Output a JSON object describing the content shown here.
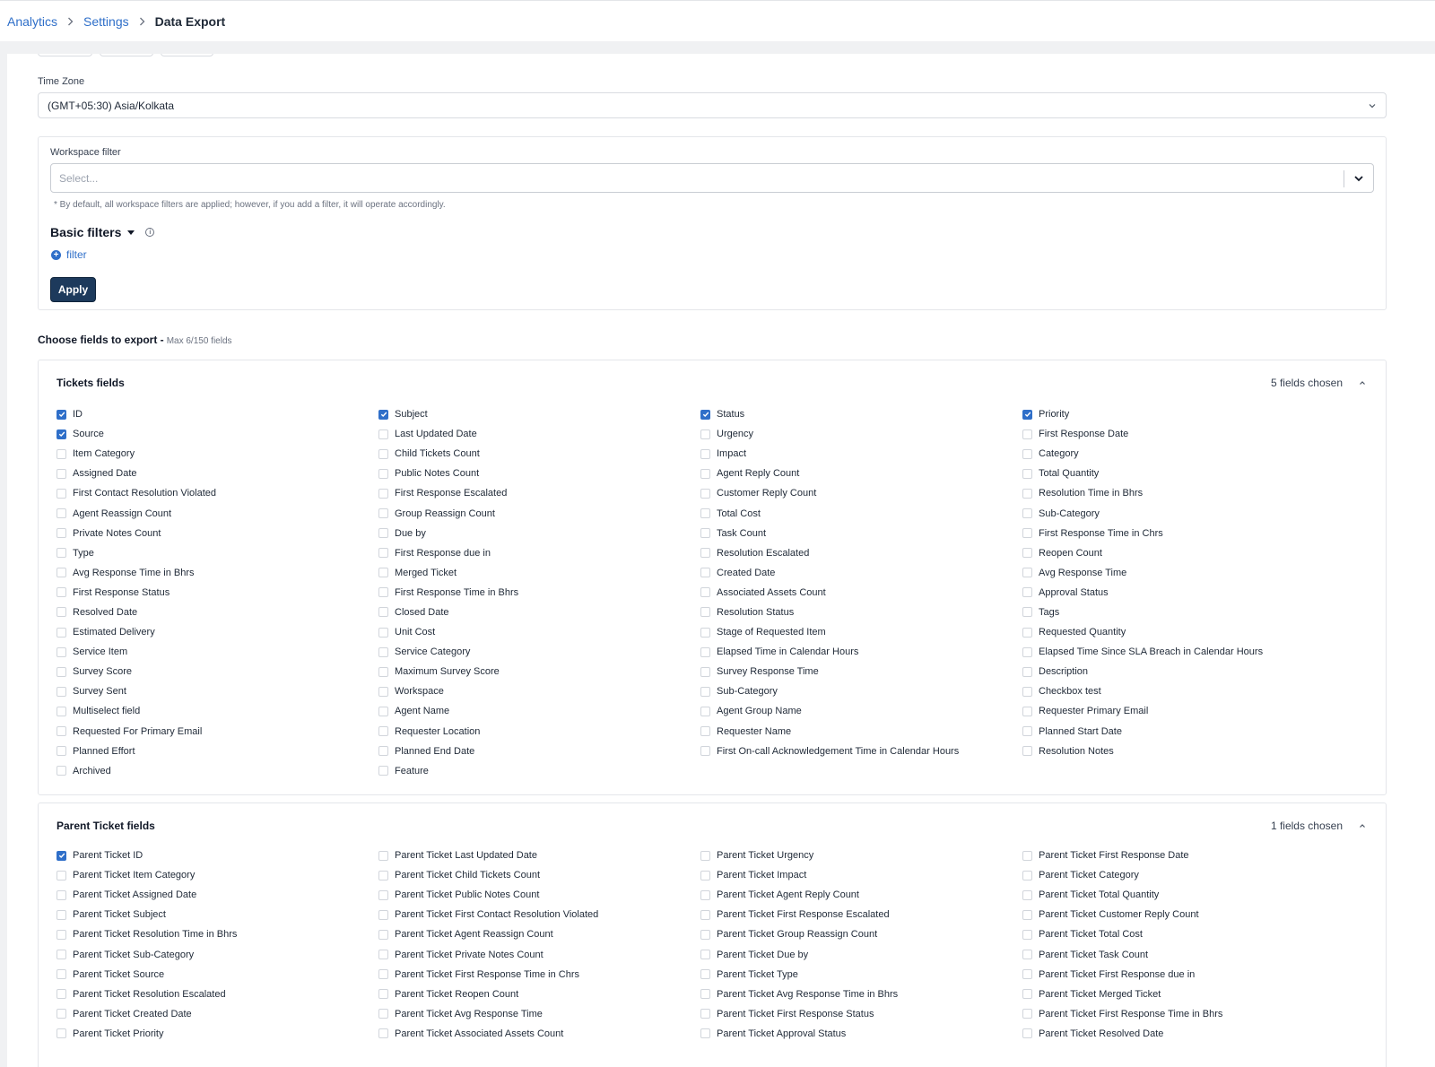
{
  "breadcrumb": {
    "items": [
      "Analytics",
      "Settings"
    ],
    "current": "Data Export"
  },
  "timezone": {
    "label": "Time Zone",
    "value": "(GMT+05:30) Asia/Kolkata"
  },
  "workspace_filter": {
    "label": "Workspace filter",
    "placeholder": "Select...",
    "hint": "* By default, all workspace filters are applied; however, if you add a filter, it will operate accordingly."
  },
  "basic_filters": {
    "title": "Basic filters",
    "add_label": "filter",
    "apply_label": "Apply"
  },
  "choose_fields": {
    "title": "Choose fields to export -",
    "max": "Max 6/150 fields"
  },
  "sections": [
    {
      "title": "Tickets fields",
      "chosen": "5 fields chosen",
      "fields": [
        {
          "label": "ID",
          "checked": true
        },
        {
          "label": "Subject",
          "checked": true
        },
        {
          "label": "Status",
          "checked": true
        },
        {
          "label": "Priority",
          "checked": true
        },
        {
          "label": "Source",
          "checked": true
        },
        {
          "label": "Last Updated Date",
          "checked": false
        },
        {
          "label": "Urgency",
          "checked": false
        },
        {
          "label": "First Response Date",
          "checked": false
        },
        {
          "label": "Item Category",
          "checked": false
        },
        {
          "label": "Child Tickets Count",
          "checked": false
        },
        {
          "label": "Impact",
          "checked": false
        },
        {
          "label": "Category",
          "checked": false
        },
        {
          "label": "Assigned Date",
          "checked": false
        },
        {
          "label": "Public Notes Count",
          "checked": false
        },
        {
          "label": "Agent Reply Count",
          "checked": false
        },
        {
          "label": "Total Quantity",
          "checked": false
        },
        {
          "label": "First Contact Resolution Violated",
          "checked": false
        },
        {
          "label": "First Response Escalated",
          "checked": false
        },
        {
          "label": "Customer Reply Count",
          "checked": false
        },
        {
          "label": "Resolution Time in Bhrs",
          "checked": false
        },
        {
          "label": "Agent Reassign Count",
          "checked": false
        },
        {
          "label": "Group Reassign Count",
          "checked": false
        },
        {
          "label": "Total Cost",
          "checked": false
        },
        {
          "label": "Sub-Category",
          "checked": false
        },
        {
          "label": "Private Notes Count",
          "checked": false
        },
        {
          "label": "Due by",
          "checked": false
        },
        {
          "label": "Task Count",
          "checked": false
        },
        {
          "label": "First Response Time in Chrs",
          "checked": false
        },
        {
          "label": "Type",
          "checked": false
        },
        {
          "label": "First Response due in",
          "checked": false
        },
        {
          "label": "Resolution Escalated",
          "checked": false
        },
        {
          "label": "Reopen Count",
          "checked": false
        },
        {
          "label": "Avg Response Time in Bhrs",
          "checked": false
        },
        {
          "label": "Merged Ticket",
          "checked": false
        },
        {
          "label": "Created Date",
          "checked": false
        },
        {
          "label": "Avg Response Time",
          "checked": false
        },
        {
          "label": "First Response Status",
          "checked": false
        },
        {
          "label": "First Response Time in Bhrs",
          "checked": false
        },
        {
          "label": "Associated Assets Count",
          "checked": false
        },
        {
          "label": "Approval Status",
          "checked": false
        },
        {
          "label": "Resolved Date",
          "checked": false
        },
        {
          "label": "Closed Date",
          "checked": false
        },
        {
          "label": "Resolution Status",
          "checked": false
        },
        {
          "label": "Tags",
          "checked": false
        },
        {
          "label": "Estimated Delivery",
          "checked": false
        },
        {
          "label": "Unit Cost",
          "checked": false
        },
        {
          "label": "Stage of Requested Item",
          "checked": false
        },
        {
          "label": "Requested Quantity",
          "checked": false
        },
        {
          "label": "Service Item",
          "checked": false
        },
        {
          "label": "Service Category",
          "checked": false
        },
        {
          "label": "Elapsed Time in Calendar Hours",
          "checked": false
        },
        {
          "label": "Elapsed Time Since SLA Breach in Calendar Hours",
          "checked": false
        },
        {
          "label": "Survey Score",
          "checked": false
        },
        {
          "label": "Maximum Survey Score",
          "checked": false
        },
        {
          "label": "Survey Response Time",
          "checked": false
        },
        {
          "label": "Description",
          "checked": false
        },
        {
          "label": "Survey Sent",
          "checked": false
        },
        {
          "label": "Workspace",
          "checked": false
        },
        {
          "label": "Sub-Category",
          "checked": false
        },
        {
          "label": "Checkbox test",
          "checked": false
        },
        {
          "label": "Multiselect field",
          "checked": false
        },
        {
          "label": "Agent Name",
          "checked": false
        },
        {
          "label": "Agent Group Name",
          "checked": false
        },
        {
          "label": "Requester Primary Email",
          "checked": false
        },
        {
          "label": "Requested For Primary Email",
          "checked": false
        },
        {
          "label": "Requester Location",
          "checked": false
        },
        {
          "label": "Requester Name",
          "checked": false
        },
        {
          "label": "Planned Start Date",
          "checked": false
        },
        {
          "label": "Planned Effort",
          "checked": false
        },
        {
          "label": "Planned End Date",
          "checked": false
        },
        {
          "label": "First On-call Acknowledgement Time in Calendar Hours",
          "checked": false
        },
        {
          "label": "Resolution Notes",
          "checked": false
        },
        {
          "label": "Archived",
          "checked": false
        },
        {
          "label": "Feature",
          "checked": false
        }
      ]
    },
    {
      "title": "Parent Ticket fields",
      "chosen": "1 fields chosen",
      "fields": [
        {
          "label": "Parent Ticket ID",
          "checked": true
        },
        {
          "label": "Parent Ticket Last Updated Date",
          "checked": false
        },
        {
          "label": "Parent Ticket Urgency",
          "checked": false
        },
        {
          "label": "Parent Ticket First Response Date",
          "checked": false
        },
        {
          "label": "Parent Ticket Item Category",
          "checked": false
        },
        {
          "label": "Parent Ticket Child Tickets Count",
          "checked": false
        },
        {
          "label": "Parent Ticket Impact",
          "checked": false
        },
        {
          "label": "Parent Ticket Category",
          "checked": false
        },
        {
          "label": "Parent Ticket Assigned Date",
          "checked": false
        },
        {
          "label": "Parent Ticket Public Notes Count",
          "checked": false
        },
        {
          "label": "Parent Ticket Agent Reply Count",
          "checked": false
        },
        {
          "label": "Parent Ticket Total Quantity",
          "checked": false
        },
        {
          "label": "Parent Ticket Subject",
          "checked": false
        },
        {
          "label": "Parent Ticket First Contact Resolution Violated",
          "checked": false
        },
        {
          "label": "Parent Ticket First Response Escalated",
          "checked": false
        },
        {
          "label": "Parent Ticket Customer Reply Count",
          "checked": false
        },
        {
          "label": "Parent Ticket Resolution Time in Bhrs",
          "checked": false
        },
        {
          "label": "Parent Ticket Agent Reassign Count",
          "checked": false
        },
        {
          "label": "Parent Ticket Group Reassign Count",
          "checked": false
        },
        {
          "label": "Parent Ticket Total Cost",
          "checked": false
        },
        {
          "label": "Parent Ticket Sub-Category",
          "checked": false
        },
        {
          "label": "Parent Ticket Private Notes Count",
          "checked": false
        },
        {
          "label": "Parent Ticket Due by",
          "checked": false
        },
        {
          "label": "Parent Ticket Task Count",
          "checked": false
        },
        {
          "label": "Parent Ticket Source",
          "checked": false
        },
        {
          "label": "Parent Ticket First Response Time in Chrs",
          "checked": false
        },
        {
          "label": "Parent Ticket Type",
          "checked": false
        },
        {
          "label": "Parent Ticket First Response due in",
          "checked": false
        },
        {
          "label": "Parent Ticket Resolution Escalated",
          "checked": false
        },
        {
          "label": "Parent Ticket Reopen Count",
          "checked": false
        },
        {
          "label": "Parent Ticket Avg Response Time in Bhrs",
          "checked": false
        },
        {
          "label": "Parent Ticket Merged Ticket",
          "checked": false
        },
        {
          "label": "Parent Ticket Created Date",
          "checked": false
        },
        {
          "label": "Parent Ticket Avg Response Time",
          "checked": false
        },
        {
          "label": "Parent Ticket First Response Status",
          "checked": false
        },
        {
          "label": "Parent Ticket First Response Time in Bhrs",
          "checked": false
        },
        {
          "label": "Parent Ticket Priority",
          "checked": false
        },
        {
          "label": "Parent Ticket Associated Assets Count",
          "checked": false
        },
        {
          "label": "Parent Ticket Approval Status",
          "checked": false
        },
        {
          "label": "Parent Ticket Resolved Date",
          "checked": false
        }
      ]
    }
  ]
}
